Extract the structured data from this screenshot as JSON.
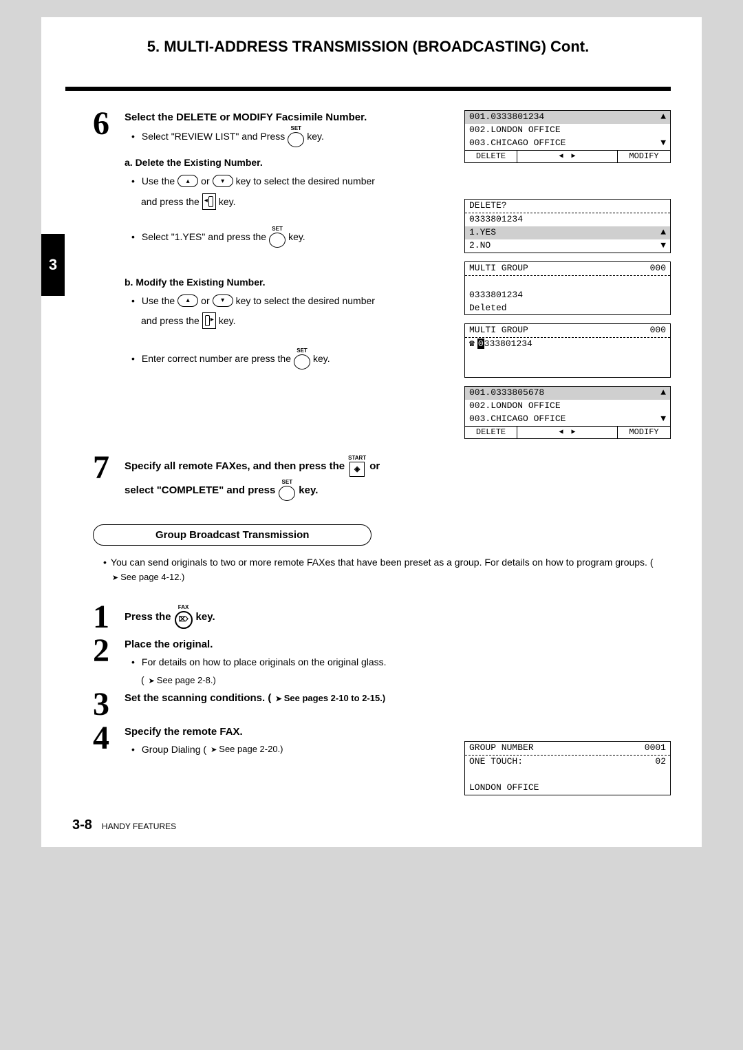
{
  "header": {
    "title": "5. MULTI-ADDRESS TRANSMISSION (BROADCASTING) Cont."
  },
  "side_tab": "3",
  "step6": {
    "title": "Select the DELETE or MODIFY Facsimile Number.",
    "bullet1_a": "Select \"REVIEW LIST\" and Press",
    "bullet1_b": "key.",
    "sub_a_title": "a. Delete the Existing Number.",
    "sub_a_b1_a": "Use the",
    "sub_a_b1_b": "or",
    "sub_a_b1_c": "key to select the desired number",
    "sub_a_b1_d": "and press the",
    "sub_a_b1_e": "key.",
    "sub_a_b2_a": "Select \"1.YES\" and press the",
    "sub_a_b2_b": "key.",
    "sub_b_title": "b. Modify the Existing Number.",
    "sub_b_b1_a": "Use the",
    "sub_b_b1_b": "or",
    "sub_b_b1_c": "key to select the desired number",
    "sub_b_b1_d": "and press the",
    "sub_b_b1_e": "key.",
    "sub_b_b2_a": "Enter correct number are press the",
    "sub_b_b2_b": "key."
  },
  "lcd1": {
    "r1": "001.0333801234",
    "r2": "002.LONDON OFFICE",
    "r3": "003.CHICAGO OFFICE",
    "delete": "DELETE",
    "modify": "MODIFY"
  },
  "lcd_delete": {
    "r1": "DELETE?",
    "r2": "0333801234",
    "r3": "1.YES",
    "r4": "2.NO"
  },
  "lcd_multi1": {
    "r1a": "MULTI GROUP",
    "r1b": "000",
    "r3": "0333801234",
    "r4": "Deleted"
  },
  "lcd_multi2": {
    "r1a": "MULTI GROUP",
    "r1b": "000",
    "r2_first": "0",
    "r2_rest": "333801234"
  },
  "lcd2": {
    "r1": "001.0333805678",
    "r2": "002.LONDON OFFICE",
    "r3": "003.CHICAGO OFFICE",
    "delete": "DELETE",
    "modify": "MODIFY"
  },
  "step7": {
    "line1_a": "Specify all remote FAXes, and then press the",
    "line1_b": "or",
    "line2_a": "select \"COMPLETE\" and press",
    "line2_b": "key."
  },
  "group_section": {
    "pill": "Group Broadcast Transmission",
    "note": "You can send originals to two or more remote FAXes that have been preset as a group. For details on how to program groups. (",
    "note_ref": "See page 4-12.)"
  },
  "g_steps": {
    "s1_a": "Press the",
    "s1_b": "key.",
    "s2_title": "Place the original.",
    "s2_body_a": "For details on how to place originals on the original glass.",
    "s2_body_b": "(",
    "s2_ref": "See page 2-8.)",
    "s3_a": "Set the scanning conditions. (",
    "s3_ref": "See pages 2-10 to 2-15.)",
    "s4_title": "Specify the remote FAX.",
    "s4_body_a": "Group Dialing (",
    "s4_ref": "See page 2-20.)"
  },
  "lcd_group": {
    "r1a": "GROUP NUMBER",
    "r1b": "0001",
    "r2a": "ONE TOUCH:",
    "r2b": "02",
    "r4": "LONDON OFFICE"
  },
  "labels": {
    "set": "SET",
    "start": "START",
    "fax": "FAX"
  },
  "footer": {
    "page": "3-8",
    "section": "HANDY FEATURES"
  }
}
